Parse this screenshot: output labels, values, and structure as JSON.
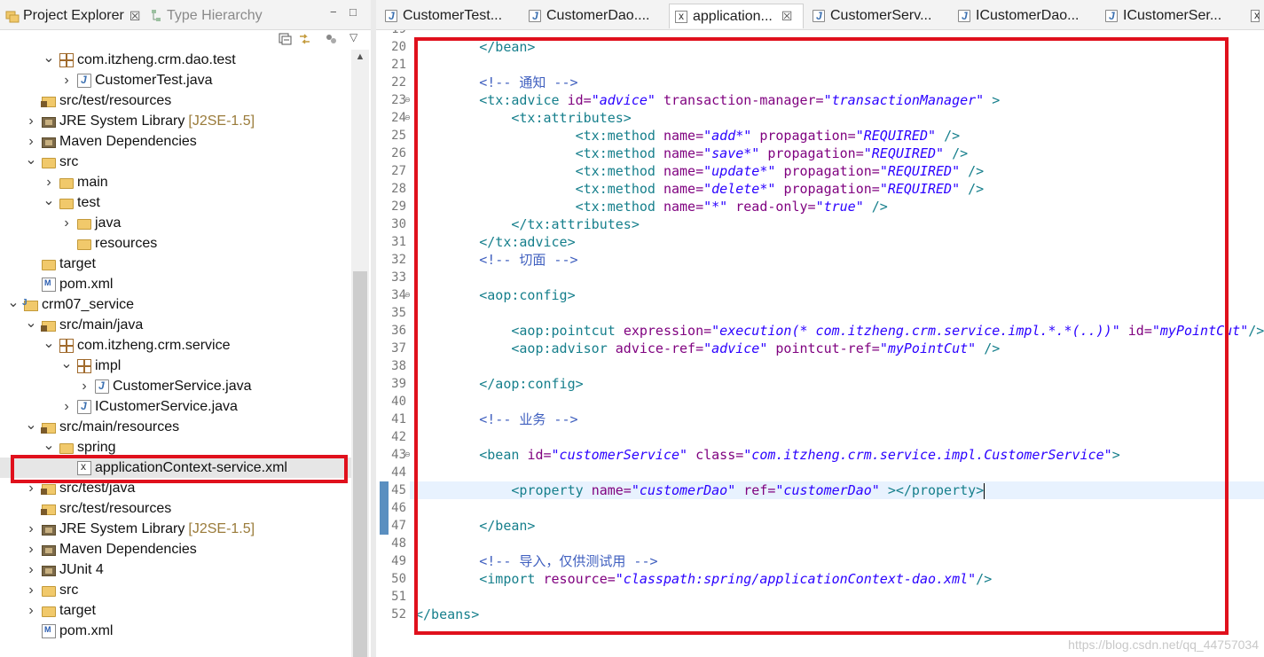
{
  "left_panel": {
    "tabs": [
      {
        "label": "Project Explorer",
        "close": "☒",
        "active": true
      },
      {
        "label": "Type Hierarchy",
        "active": false
      }
    ],
    "controls": {
      "minimize": "−",
      "maximize": "□"
    },
    "toolbar": {
      "collapse": "collapse-all-icon",
      "link": "link-with-editor-icon",
      "filter": "filter-icon",
      "menu": "▽"
    },
    "tree": [
      {
        "indent": 2,
        "twisty": "v",
        "icon": "package",
        "label": "com.itzheng.crm.dao.test"
      },
      {
        "indent": 3,
        "twisty": ">",
        "icon": "java",
        "label": "CustomerTest.java"
      },
      {
        "indent": 1,
        "twisty": "",
        "icon": "srcfolder",
        "label": "src/test/resources"
      },
      {
        "indent": 1,
        "twisty": ">",
        "icon": "lib",
        "label": "JRE System Library",
        "suffix": "[J2SE-1.5]"
      },
      {
        "indent": 1,
        "twisty": ">",
        "icon": "lib",
        "label": "Maven Dependencies"
      },
      {
        "indent": 1,
        "twisty": "v",
        "icon": "folder",
        "label": "src"
      },
      {
        "indent": 2,
        "twisty": ">",
        "icon": "folder",
        "label": "main"
      },
      {
        "indent": 2,
        "twisty": "v",
        "icon": "folder",
        "label": "test"
      },
      {
        "indent": 3,
        "twisty": ">",
        "icon": "folder",
        "label": "java"
      },
      {
        "indent": 3,
        "twisty": "",
        "icon": "folder",
        "label": "resources"
      },
      {
        "indent": 1,
        "twisty": "",
        "icon": "folder",
        "label": "target"
      },
      {
        "indent": 1,
        "twisty": "",
        "icon": "pom",
        "label": "pom.xml"
      },
      {
        "indent": 0,
        "twisty": "v",
        "icon": "project",
        "label": "crm07_service"
      },
      {
        "indent": 1,
        "twisty": "v",
        "icon": "srcfolder",
        "label": "src/main/java"
      },
      {
        "indent": 2,
        "twisty": "v",
        "icon": "package",
        "label": "com.itzheng.crm.service"
      },
      {
        "indent": 3,
        "twisty": "v",
        "icon": "package",
        "label": "impl"
      },
      {
        "indent": 4,
        "twisty": ">",
        "icon": "java",
        "label": "CustomerService.java"
      },
      {
        "indent": 3,
        "twisty": ">",
        "icon": "java",
        "label": "ICustomerService.java"
      },
      {
        "indent": 1,
        "twisty": "v",
        "icon": "srcfolder",
        "label": "src/main/resources"
      },
      {
        "indent": 2,
        "twisty": "v",
        "icon": "folder",
        "label": "spring"
      },
      {
        "indent": 3,
        "twisty": "",
        "icon": "xml",
        "label": "applicationContext-service.xml",
        "selected": true
      },
      {
        "indent": 1,
        "twisty": ">",
        "icon": "srcfolder",
        "label": "src/test/java"
      },
      {
        "indent": 1,
        "twisty": "",
        "icon": "srcfolder",
        "label": "src/test/resources"
      },
      {
        "indent": 1,
        "twisty": ">",
        "icon": "lib",
        "label": "JRE System Library",
        "suffix": "[J2SE-1.5]"
      },
      {
        "indent": 1,
        "twisty": ">",
        "icon": "lib",
        "label": "Maven Dependencies"
      },
      {
        "indent": 1,
        "twisty": ">",
        "icon": "lib",
        "label": "JUnit 4"
      },
      {
        "indent": 1,
        "twisty": ">",
        "icon": "folder",
        "label": "src"
      },
      {
        "indent": 1,
        "twisty": ">",
        "icon": "folder",
        "label": "target"
      },
      {
        "indent": 1,
        "twisty": "",
        "icon": "pom",
        "label": "pom.xml"
      }
    ]
  },
  "editor": {
    "tabs": [
      {
        "label": "CustomerTest...",
        "icon": "java"
      },
      {
        "label": "CustomerDao....",
        "icon": "java"
      },
      {
        "label": "application...",
        "icon": "xml",
        "active": true,
        "close": "☒"
      },
      {
        "label": "CustomerServ...",
        "icon": "java"
      },
      {
        "label": "ICustomerDao...",
        "icon": "java"
      },
      {
        "label": "ICustomerSer...",
        "icon": "java"
      },
      {
        "label": "c",
        "icon": "xml"
      }
    ],
    "first_line": 19,
    "lines": [
      {
        "n": 19,
        "segs": []
      },
      {
        "n": 20,
        "segs": [
          {
            "t": "        "
          },
          {
            "c": "tag",
            "t": "</bean>"
          }
        ]
      },
      {
        "n": 21,
        "segs": []
      },
      {
        "n": 22,
        "segs": [
          {
            "t": "        "
          },
          {
            "c": "cmt",
            "t": "<!-- 通知 -->"
          }
        ]
      },
      {
        "n": 23,
        "segs": [
          {
            "t": "        "
          },
          {
            "c": "tag",
            "t": "<tx:advice "
          },
          {
            "c": "attr2",
            "t": "id="
          },
          {
            "c": "val",
            "t": "\"advice\""
          },
          {
            "t": " "
          },
          {
            "c": "attr2",
            "t": "transaction-manager="
          },
          {
            "c": "val",
            "t": "\"transactionManager\""
          },
          {
            "t": " "
          },
          {
            "c": "tag",
            "t": ">"
          }
        ],
        "fold": true
      },
      {
        "n": 24,
        "segs": [
          {
            "t": "            "
          },
          {
            "c": "tag",
            "t": "<tx:attributes>"
          }
        ],
        "fold": true
      },
      {
        "n": 25,
        "segs": [
          {
            "t": "                    "
          },
          {
            "c": "tag",
            "t": "<tx:method "
          },
          {
            "c": "attr2",
            "t": "name="
          },
          {
            "c": "val",
            "t": "\"add*\""
          },
          {
            "t": " "
          },
          {
            "c": "attr2",
            "t": "propagation="
          },
          {
            "c": "val",
            "t": "\"REQUIRED\""
          },
          {
            "t": " "
          },
          {
            "c": "tag",
            "t": "/>"
          }
        ]
      },
      {
        "n": 26,
        "segs": [
          {
            "t": "                    "
          },
          {
            "c": "tag",
            "t": "<tx:method "
          },
          {
            "c": "attr2",
            "t": "name="
          },
          {
            "c": "val",
            "t": "\"save*\""
          },
          {
            "t": " "
          },
          {
            "c": "attr2",
            "t": "propagation="
          },
          {
            "c": "val",
            "t": "\"REQUIRED\""
          },
          {
            "t": " "
          },
          {
            "c": "tag",
            "t": "/>"
          }
        ]
      },
      {
        "n": 27,
        "segs": [
          {
            "t": "                    "
          },
          {
            "c": "tag",
            "t": "<tx:method "
          },
          {
            "c": "attr2",
            "t": "name="
          },
          {
            "c": "val",
            "t": "\"update*\""
          },
          {
            "t": " "
          },
          {
            "c": "attr2",
            "t": "propagation="
          },
          {
            "c": "val",
            "t": "\"REQUIRED\""
          },
          {
            "t": " "
          },
          {
            "c": "tag",
            "t": "/>"
          }
        ]
      },
      {
        "n": 28,
        "segs": [
          {
            "t": "                    "
          },
          {
            "c": "tag",
            "t": "<tx:method "
          },
          {
            "c": "attr2",
            "t": "name="
          },
          {
            "c": "val",
            "t": "\"delete*\""
          },
          {
            "t": " "
          },
          {
            "c": "attr2",
            "t": "propagation="
          },
          {
            "c": "val",
            "t": "\"REQUIRED\""
          },
          {
            "t": " "
          },
          {
            "c": "tag",
            "t": "/>"
          }
        ]
      },
      {
        "n": 29,
        "segs": [
          {
            "t": "                    "
          },
          {
            "c": "tag",
            "t": "<tx:method "
          },
          {
            "c": "attr2",
            "t": "name="
          },
          {
            "c": "val",
            "t": "\"*\""
          },
          {
            "t": " "
          },
          {
            "c": "attr2",
            "t": "read-only="
          },
          {
            "c": "val",
            "t": "\"true\""
          },
          {
            "t": " "
          },
          {
            "c": "tag",
            "t": "/>"
          }
        ]
      },
      {
        "n": 30,
        "segs": [
          {
            "t": "            "
          },
          {
            "c": "tag",
            "t": "</tx:attributes>"
          }
        ]
      },
      {
        "n": 31,
        "segs": [
          {
            "t": "        "
          },
          {
            "c": "tag",
            "t": "</tx:advice>"
          }
        ]
      },
      {
        "n": 32,
        "segs": [
          {
            "t": "        "
          },
          {
            "c": "cmt",
            "t": "<!-- 切面 -->"
          }
        ]
      },
      {
        "n": 33,
        "segs": []
      },
      {
        "n": 34,
        "segs": [
          {
            "t": "        "
          },
          {
            "c": "tag",
            "t": "<aop:config>"
          }
        ],
        "fold": true
      },
      {
        "n": 35,
        "segs": []
      },
      {
        "n": 36,
        "segs": [
          {
            "t": "            "
          },
          {
            "c": "tag",
            "t": "<aop:pointcut "
          },
          {
            "c": "attr2",
            "t": "expression="
          },
          {
            "c": "val",
            "t": "\"execution(* com.itzheng.crm.service.impl.*.*(..))\""
          },
          {
            "t": " "
          },
          {
            "c": "attr2",
            "t": "id="
          },
          {
            "c": "val",
            "t": "\"myPointCut\""
          },
          {
            "c": "tag",
            "t": "/>"
          }
        ]
      },
      {
        "n": 37,
        "segs": [
          {
            "t": "            "
          },
          {
            "c": "tag",
            "t": "<aop:advisor "
          },
          {
            "c": "attr2",
            "t": "advice-ref="
          },
          {
            "c": "val",
            "t": "\"advice\""
          },
          {
            "t": " "
          },
          {
            "c": "attr2",
            "t": "pointcut-ref="
          },
          {
            "c": "val",
            "t": "\"myPointCut\""
          },
          {
            "t": " "
          },
          {
            "c": "tag",
            "t": "/>"
          }
        ]
      },
      {
        "n": 38,
        "segs": []
      },
      {
        "n": 39,
        "segs": [
          {
            "t": "        "
          },
          {
            "c": "tag",
            "t": "</aop:config>"
          }
        ]
      },
      {
        "n": 40,
        "segs": []
      },
      {
        "n": 41,
        "segs": [
          {
            "t": "        "
          },
          {
            "c": "cmt",
            "t": "<!-- 业务 -->"
          }
        ]
      },
      {
        "n": 42,
        "segs": []
      },
      {
        "n": 43,
        "segs": [
          {
            "t": "        "
          },
          {
            "c": "tag",
            "t": "<bean "
          },
          {
            "c": "attr2",
            "t": "id="
          },
          {
            "c": "val",
            "t": "\"customerService\""
          },
          {
            "t": " "
          },
          {
            "c": "attr2",
            "t": "class="
          },
          {
            "c": "val",
            "t": "\"com.itzheng.crm.service.impl.CustomerService\""
          },
          {
            "c": "tag",
            "t": ">"
          }
        ],
        "fold": true
      },
      {
        "n": 44,
        "segs": []
      },
      {
        "n": 45,
        "segs": [
          {
            "t": "            "
          },
          {
            "c": "tag",
            "t": "<property "
          },
          {
            "c": "attr2",
            "t": "name="
          },
          {
            "c": "val",
            "t": "\"customerDao\""
          },
          {
            "t": " "
          },
          {
            "c": "attr2",
            "t": "ref="
          },
          {
            "c": "val",
            "t": "\"customerDao\""
          },
          {
            "t": " "
          },
          {
            "c": "tag",
            "t": "></property>"
          }
        ],
        "cursor": true
      },
      {
        "n": 46,
        "segs": []
      },
      {
        "n": 47,
        "segs": [
          {
            "t": "        "
          },
          {
            "c": "tag",
            "t": "</bean>"
          }
        ]
      },
      {
        "n": 48,
        "segs": []
      },
      {
        "n": 49,
        "segs": [
          {
            "t": "        "
          },
          {
            "c": "cmt",
            "t": "<!-- 导入，仅供测试用 -->"
          }
        ]
      },
      {
        "n": 50,
        "segs": [
          {
            "t": "        "
          },
          {
            "c": "tag",
            "t": "<import "
          },
          {
            "c": "attr2",
            "t": "resource="
          },
          {
            "c": "val",
            "t": "\"classpath:spring/applicationContext-dao.xml\""
          },
          {
            "c": "tag",
            "t": "/>"
          }
        ]
      },
      {
        "n": 51,
        "segs": []
      },
      {
        "n": 52,
        "segs": [
          {
            "c": "tag",
            "t": "</beans>"
          }
        ]
      }
    ]
  },
  "watermark": "https://blog.csdn.net/qq_44757034",
  "colors": {
    "highlight": "#e0101c",
    "tag": "#167f8c",
    "attr": "#7f007f",
    "value": "#2a00ff",
    "comment": "#3f5fbf"
  }
}
